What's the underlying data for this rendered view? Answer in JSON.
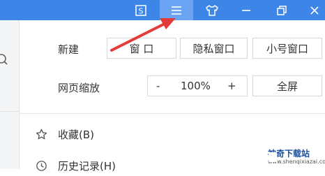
{
  "titlebar": {
    "buttons": [
      {
        "name": "sync-icon"
      },
      {
        "name": "menu-icon"
      },
      {
        "name": "skin-icon"
      },
      {
        "name": "minimize-icon"
      },
      {
        "name": "restore-icon"
      },
      {
        "name": "close-icon"
      }
    ],
    "accent_color": "#3d86e8",
    "active_button_color": "#6aa4f3"
  },
  "menu": {
    "new_row": {
      "label": "新建",
      "buttons": [
        "窗 口",
        "隐私窗口",
        "小号窗口"
      ]
    },
    "zoom_row": {
      "label": "网页缩放",
      "minus": "-",
      "value": "100%",
      "plus": "+",
      "fullscreen": "全屏"
    },
    "items": [
      {
        "icon": "star-icon",
        "label": "收藏(B)"
      },
      {
        "icon": "history-icon",
        "label": "历史记录(H)"
      }
    ]
  },
  "watermark": {
    "title": "神奇下载站",
    "url": "www.shenqixiazai.com"
  },
  "annotation": {
    "color": "#e23b3b"
  }
}
